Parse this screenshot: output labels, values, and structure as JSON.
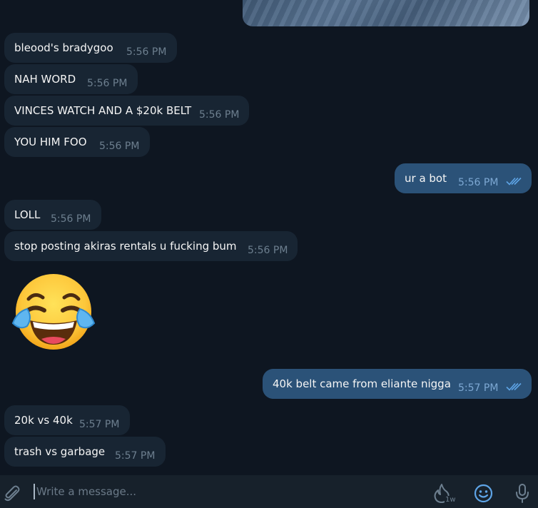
{
  "messages": [
    {
      "dir": "in",
      "text": "bleood's bradygoo",
      "time": "5:56 PM"
    },
    {
      "dir": "in",
      "text": "NAH WORD",
      "time": "5:56 PM"
    },
    {
      "dir": "in",
      "text": "VINCES WATCH AND A $20k BELT",
      "time": "5:56 PM"
    },
    {
      "dir": "in",
      "text": "YOU HIM FOO",
      "time": "5:56 PM"
    },
    {
      "dir": "out",
      "text": "ur a bot",
      "time": "5:56 PM"
    },
    {
      "dir": "in",
      "text": "LOLL",
      "time": "5:56 PM"
    },
    {
      "dir": "in",
      "text": "stop posting akiras rentals u fucking bum",
      "time": "5:56 PM"
    },
    {
      "dir": "out",
      "text": "40k belt came from eliante nigga",
      "time": "5:57 PM"
    },
    {
      "dir": "in",
      "text": "20k vs 40k",
      "time": "5:57 PM"
    },
    {
      "dir": "in",
      "text": "trash vs garbage",
      "time": "5:57 PM"
    }
  ],
  "emoji_message": {
    "icon": "tears-of-joy-emoji"
  },
  "composer": {
    "placeholder": "Write a message...",
    "attach_icon": "paperclip-icon",
    "bot_commands_icon": "flame-icon",
    "bot_commands_badge": "1w",
    "emoji_icon": "smiley-icon",
    "voice_icon": "microphone-icon"
  },
  "colors": {
    "background": "#0e1621",
    "incoming": "#182533",
    "outgoing": "#2b5278",
    "composer": "#17212b",
    "accent": "#5ea4e6"
  }
}
